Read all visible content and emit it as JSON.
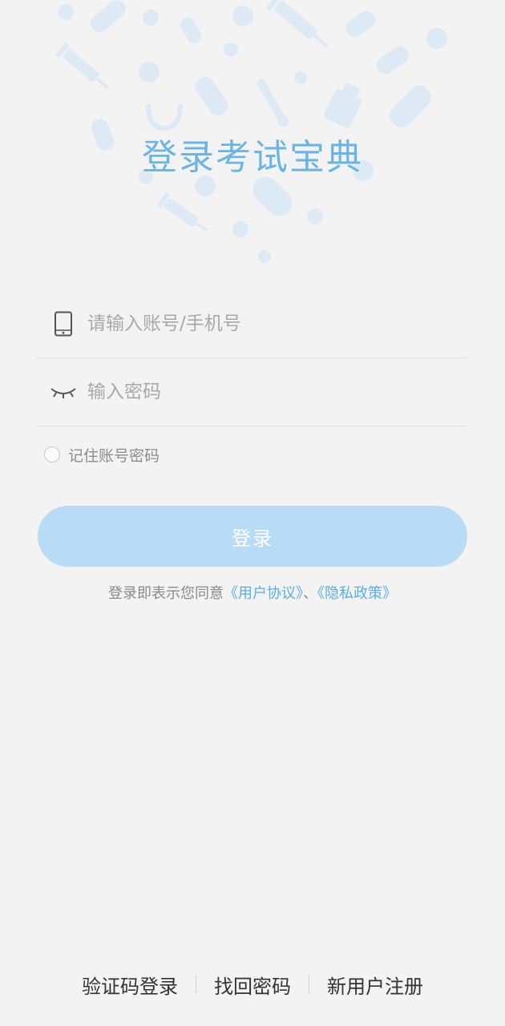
{
  "header": {
    "title": "登录考试宝典"
  },
  "form": {
    "account": {
      "placeholder": "请输入账号/手机号",
      "value": "",
      "icon": "phone-icon"
    },
    "password": {
      "placeholder": "输入密码",
      "value": "",
      "icon": "eye-closed-icon"
    },
    "remember_label": "记住账号密码",
    "remember_checked": false
  },
  "login_button": {
    "label": "登录"
  },
  "agreement": {
    "prefix": "登录即表示您同意",
    "user_agreement": "《用户协议》",
    "separator": "、",
    "privacy_policy": "《隐私政策》"
  },
  "footer": {
    "sms_login": "验证码登录",
    "forgot_password": "找回密码",
    "register": "新用户注册"
  },
  "colors": {
    "title": "#6bb4e6",
    "button": "#b8dcf6",
    "link": "#5aaee3",
    "background": "#f3f3f3"
  }
}
